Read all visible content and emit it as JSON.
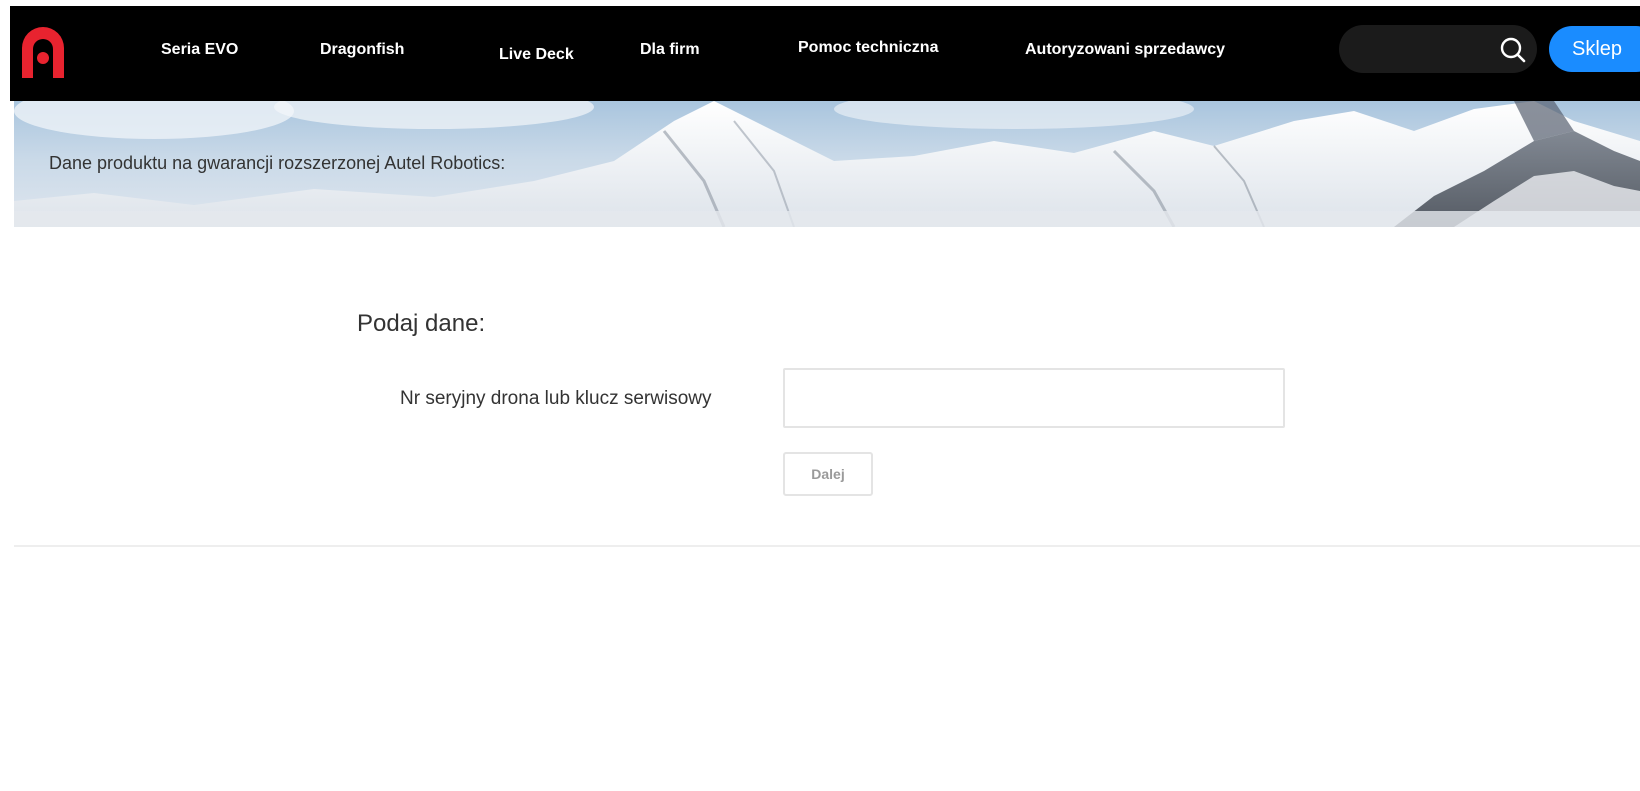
{
  "nav": {
    "items": [
      {
        "label": "Seria EVO"
      },
      {
        "label": "Dragonfish"
      },
      {
        "label": "Live Deck"
      },
      {
        "label": "Dla firm"
      },
      {
        "label": "Pomoc techniczna"
      },
      {
        "label": "Autoryzowani sprzedawcy"
      }
    ],
    "search": {
      "value": "",
      "placeholder": ""
    },
    "shop_label": "Sklep"
  },
  "banner": {
    "text": "Dane produktu na gwarancji rozszerzonej Autel Robotics:"
  },
  "form": {
    "title": "Podaj dane:",
    "serial_label": "Nr seryjny drona lub klucz serwisowy",
    "serial_value": "",
    "next_label": "Dalej"
  },
  "colors": {
    "nav_background": "#000000",
    "logo_red": "#e8232f",
    "shop_button": "#1a8cff",
    "text": "#333333"
  }
}
